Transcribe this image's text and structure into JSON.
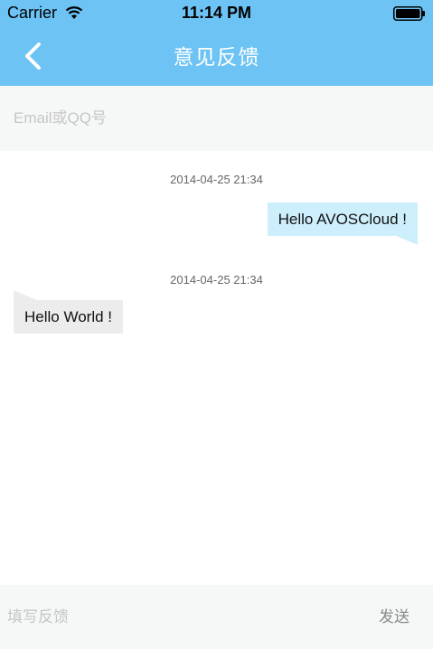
{
  "status_bar": {
    "carrier": "Carrier",
    "time": "11:14 PM",
    "wifi_icon": "wifi-icon",
    "battery_icon": "battery-icon"
  },
  "nav": {
    "back_icon": "chevron-left-icon",
    "title": "意见反馈"
  },
  "email_field": {
    "placeholder": "Email或QQ号",
    "value": ""
  },
  "messages": [
    {
      "timestamp": "2014-04-25 21:34",
      "text": "Hello AVOSCloud !",
      "side": "right"
    },
    {
      "timestamp": "2014-04-25 21:34",
      "text": "Hello World !",
      "side": "left"
    }
  ],
  "input_bar": {
    "placeholder": "填写反馈",
    "value": "",
    "send_label": "发送"
  },
  "colors": {
    "nav_background": "#6cc3f4",
    "outgoing_bubble": "#cdeefb",
    "incoming_bubble": "#ececec",
    "field_background": "#f6f7f7"
  }
}
